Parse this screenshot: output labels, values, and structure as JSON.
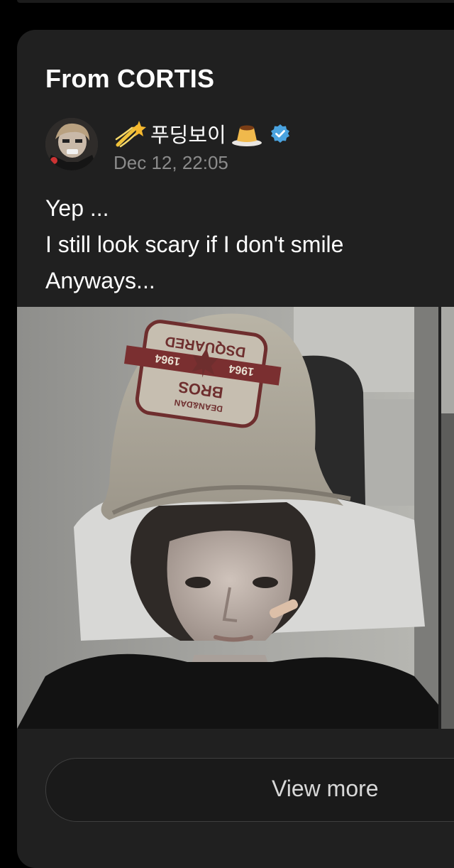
{
  "card": {
    "title": "From CORTIS"
  },
  "post": {
    "author_name": "푸딩보이",
    "author_emoji_left": "shooting-star-emoji",
    "author_emoji_right": "pudding-emoji",
    "verified_icon": "verified-badge-icon",
    "timestamp": "Dec 12, 22:05",
    "text_lines": [
      "Yep ...",
      "I still look scary if I don't smile",
      "Anyways..."
    ],
    "photo_cap_text_lines": [
      "DSQUARED",
      "1964",
      "1964",
      "BROS",
      "DEAN&DAN"
    ]
  },
  "actions": {
    "view_more_label": "View more"
  },
  "colors": {
    "background": "#000000",
    "card": "#202020",
    "secondary_text": "#8b8b8b",
    "verified": "#4aa3df"
  }
}
